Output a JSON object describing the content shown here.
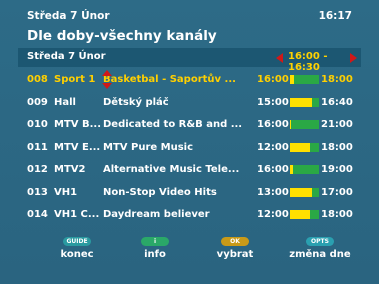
{
  "header": {
    "date": "Středa 7 Únor",
    "clock": "16:17",
    "title": "Dle doby-všechny kanály"
  },
  "filter_bar": {
    "date": "Středa 7 Únor",
    "time_range": "16:00 - 16:30"
  },
  "rows": [
    {
      "num": "008",
      "channel": "Sport 1",
      "title": "Basketbal - Saportův ...",
      "start": "16:00",
      "end": "18:00",
      "progress": 0.15,
      "selected": true
    },
    {
      "num": "009",
      "channel": "Hall",
      "title": "Dětský pláč",
      "start": "15:00",
      "end": "16:40",
      "progress": 0.75,
      "selected": false
    },
    {
      "num": "010",
      "channel": "MTV B...",
      "title": "Dedicated to R&B and ...",
      "start": "16:00",
      "end": "21:00",
      "progress": 0.05,
      "selected": false
    },
    {
      "num": "011",
      "channel": "MTV E...",
      "title": "MTV Pure Music",
      "start": "12:00",
      "end": "18:00",
      "progress": 0.7,
      "selected": false
    },
    {
      "num": "012",
      "channel": "MTV2",
      "title": "Alternative Music Tele...",
      "start": "16:00",
      "end": "19:00",
      "progress": 0.1,
      "selected": false
    },
    {
      "num": "013",
      "channel": "VH1",
      "title": "Non-Stop Video Hits",
      "start": "13:00",
      "end": "17:00",
      "progress": 0.75,
      "selected": false
    },
    {
      "num": "014",
      "channel": "VH1 C...",
      "title": "Daydream believer",
      "start": "12:00",
      "end": "18:00",
      "progress": 0.7,
      "selected": false
    }
  ],
  "footer": [
    {
      "badge": "GUIDE",
      "label": "konec",
      "color": "#2a9aa0"
    },
    {
      "badge": "i",
      "label": "info",
      "color": "#2aa868"
    },
    {
      "badge": "OK",
      "label": "vybrat",
      "color": "#c89a18"
    },
    {
      "badge": "OPTS",
      "label": "změna dne",
      "color": "#2aa0b0"
    }
  ],
  "colors": {
    "selected_text": "#ffd000",
    "progress_done": "#ffe000",
    "progress_remaining": "#2aa845",
    "arrows": "#d01818"
  }
}
